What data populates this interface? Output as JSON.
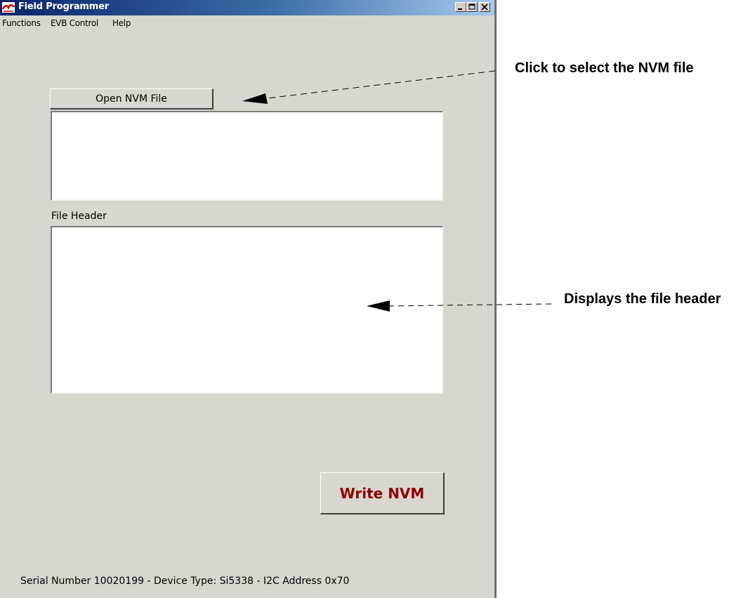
{
  "window": {
    "title": "Field Programmer",
    "controls": [
      "minimize",
      "maximize",
      "close"
    ]
  },
  "menu": {
    "items": [
      "Functions",
      "EVB Control",
      "Help"
    ]
  },
  "main": {
    "open_button_label": "Open NVM File",
    "file_path_value": "",
    "file_header_label": "File Header",
    "file_header_value": "",
    "write_button_label": "Write NVM"
  },
  "status": {
    "text": "Serial Number 10020199 - Device Type: Si5338 - I2C Address 0x70"
  },
  "annotations": {
    "open_callout": "Click to select the NVM file",
    "header_callout": "Displays the file header"
  },
  "colors": {
    "window_bg": "#d9d6cf",
    "write_button_text": "#8b0000",
    "titlebar_start": "#0a246a"
  }
}
